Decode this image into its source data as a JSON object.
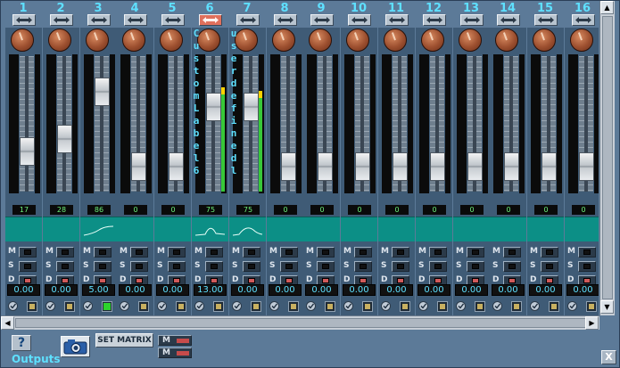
{
  "channels": [
    {
      "num": "1",
      "level": "17",
      "value": "0.00",
      "link_on": false,
      "label": "",
      "fader": 0.24,
      "meter": 0,
      "curve": "flat",
      "knob_angle": -20,
      "solo_green": true,
      "route_green": false
    },
    {
      "num": "2",
      "level": "28",
      "value": "0.00",
      "link_on": false,
      "label": "",
      "fader": 0.36,
      "meter": 0,
      "curve": "flat",
      "knob_angle": -20,
      "route_green": false
    },
    {
      "num": "3",
      "level": "86",
      "value": "5.00",
      "link_on": false,
      "label": "",
      "fader": 0.8,
      "meter": 0,
      "curve": "rise",
      "knob_angle": -20,
      "route_green": true
    },
    {
      "num": "4",
      "level": "0",
      "value": "0.00",
      "link_on": false,
      "label": "",
      "fader": 0.1,
      "meter": 0,
      "curve": "flat",
      "knob_angle": -20,
      "route_green": false
    },
    {
      "num": "5",
      "level": "0",
      "value": "0.00",
      "link_on": false,
      "label": "",
      "fader": 0.1,
      "meter": 0,
      "curve": "flat",
      "knob_angle": -20,
      "route_green": false
    },
    {
      "num": "6",
      "level": "75",
      "value": "13.00",
      "link_on": true,
      "label": "Custom Label 6",
      "fader": 0.66,
      "meter": 0.78,
      "curve": "bump",
      "knob_angle": -20,
      "route_green": false
    },
    {
      "num": "7",
      "level": "75",
      "value": "0.00",
      "link_on": false,
      "label": "user defined l",
      "fader": 0.66,
      "meter": 0.75,
      "curve": "bump2",
      "knob_angle": -20,
      "route_green": false
    },
    {
      "num": "8",
      "level": "0",
      "value": "0.00",
      "link_on": false,
      "label": "",
      "fader": 0.1,
      "meter": 0,
      "curve": "flat",
      "knob_angle": -20,
      "route_green": false
    },
    {
      "num": "9",
      "level": "0",
      "value": "0.00",
      "link_on": false,
      "label": "",
      "fader": 0.1,
      "meter": 0,
      "curve": "flat",
      "knob_angle": -20,
      "route_green": false
    },
    {
      "num": "10",
      "level": "0",
      "value": "0.00",
      "link_on": false,
      "label": "",
      "fader": 0.1,
      "meter": 0,
      "curve": "flat",
      "knob_angle": -20,
      "route_green": false
    },
    {
      "num": "11",
      "level": "0",
      "value": "0.00",
      "link_on": false,
      "label": "",
      "fader": 0.1,
      "meter": 0,
      "curve": "flat",
      "knob_angle": -20,
      "route_green": false
    },
    {
      "num": "12",
      "level": "0",
      "value": "0.00",
      "link_on": false,
      "label": "",
      "fader": 0.1,
      "meter": 0,
      "curve": "flat",
      "knob_angle": -20,
      "route_green": false
    },
    {
      "num": "13",
      "level": "0",
      "value": "0.00",
      "link_on": false,
      "label": "",
      "fader": 0.1,
      "meter": 0,
      "curve": "flat",
      "knob_angle": -20,
      "route_green": false
    },
    {
      "num": "14",
      "level": "0",
      "value": "0.00",
      "link_on": false,
      "label": "",
      "fader": 0.1,
      "meter": 0,
      "curve": "flat",
      "knob_angle": -20,
      "route_green": false
    },
    {
      "num": "15",
      "level": "0",
      "value": "0.00",
      "link_on": false,
      "label": "",
      "fader": 0.1,
      "meter": 0,
      "curve": "flat",
      "knob_angle": -20,
      "route_green": false
    },
    {
      "num": "16",
      "level": "0",
      "value": "0.00",
      "link_on": false,
      "label": "",
      "fader": 0.1,
      "meter": 0,
      "curve": "flat",
      "knob_angle": -20,
      "route_green": false
    }
  ],
  "buttons": {
    "mute": "M",
    "solo": "S",
    "dim": "D"
  },
  "toolbar": {
    "help_label": "?",
    "outputs_label": "Outputs",
    "set_matrix_label": "SET MATRIX",
    "master_mute_label": "M",
    "close_label": "X"
  },
  "scroll": {
    "up": "▲",
    "down": "▼",
    "left": "◀",
    "right": "▶"
  },
  "colors": {
    "accent": "#5ee0ff",
    "teal": "#0c8f86",
    "display_green": "#6df07a",
    "link_active": "#e0705c"
  }
}
